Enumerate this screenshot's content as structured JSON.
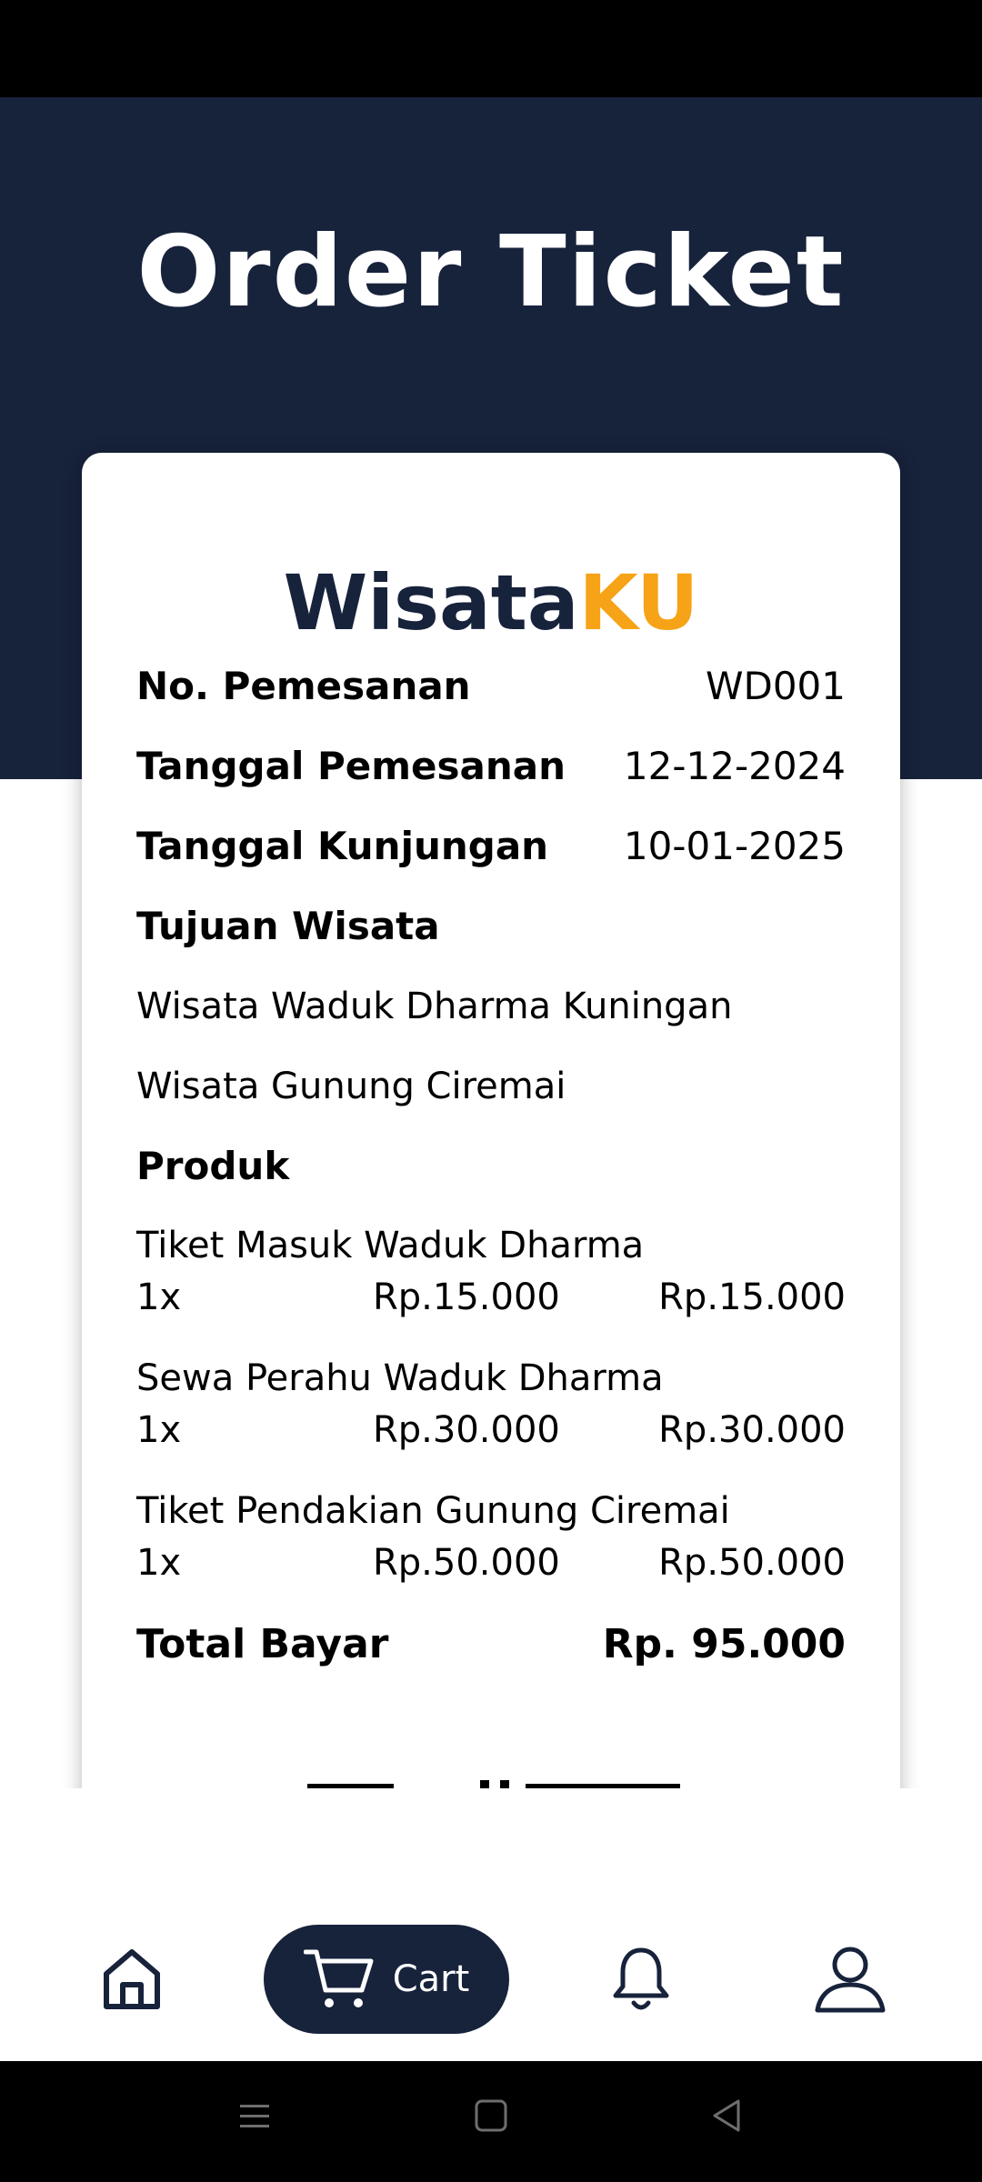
{
  "header": {
    "title": "Order Ticket"
  },
  "brand": {
    "part1": "Wisata",
    "part2": "KU"
  },
  "order": {
    "number_label": "No. Pemesanan",
    "number_value": "WD001",
    "order_date_label": "Tanggal Pemesanan",
    "order_date_value": "12-12-2024",
    "visit_date_label": "Tanggal Kunjungan",
    "visit_date_value": "10-01-2025"
  },
  "destinations": {
    "label": "Tujuan Wisata",
    "items": [
      "Wisata Waduk Dharma Kuningan",
      "Wisata Gunung Ciremai"
    ]
  },
  "products": {
    "label": "Produk",
    "items": [
      {
        "name": "Tiket Masuk Waduk Dharma",
        "qty": "1x",
        "price": "Rp.15.000",
        "subtotal": "Rp.15.000"
      },
      {
        "name": "Sewa Perahu Waduk Dharma",
        "qty": "1x",
        "price": "Rp.30.000",
        "subtotal": "Rp.30.000"
      },
      {
        "name": "Tiket Pendakian Gunung Ciremai",
        "qty": "1x",
        "price": "Rp.50.000",
        "subtotal": "Rp.50.000"
      }
    ]
  },
  "total": {
    "label": "Total Bayar",
    "value": "Rp. 95.000"
  },
  "nav": {
    "cart_label": "Cart",
    "icons": [
      "home-icon",
      "cart-icon",
      "bell-icon",
      "user-icon"
    ]
  },
  "colors": {
    "primary": "#17223b",
    "accent": "#f6a317",
    "background": "#ffffff"
  }
}
